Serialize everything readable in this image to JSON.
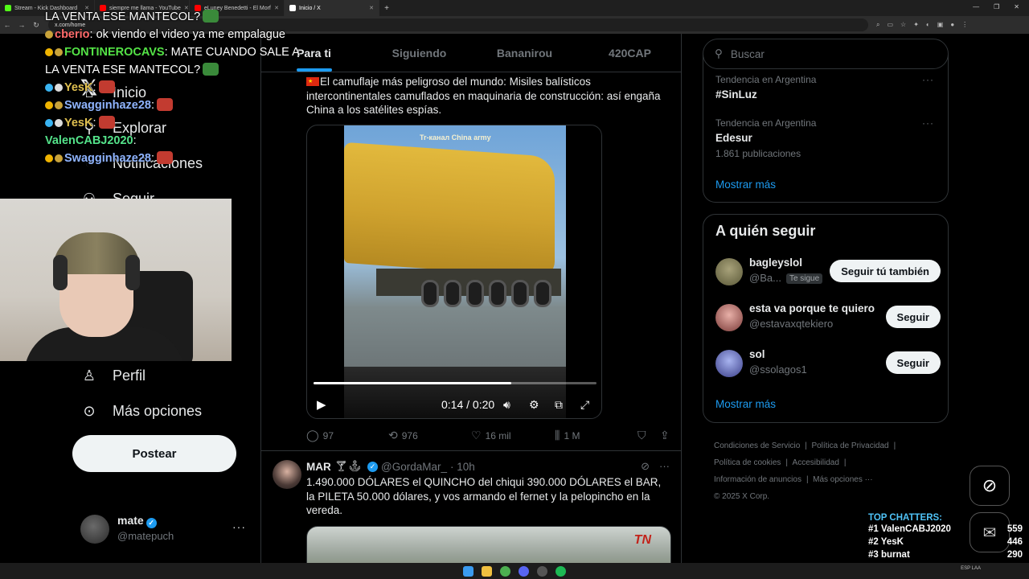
{
  "browser": {
    "tabs": [
      {
        "label": "Stream - Kick Dashboard",
        "color": "#53fc18"
      },
      {
        "label": "siempre me llama - YouTube",
        "color": "#ff0000"
      },
      {
        "label": "eLuney Benedetti - El Morf",
        "color": "#ff0000"
      },
      {
        "label": "Inicio / X",
        "color": "#ffffff"
      }
    ],
    "url": "x.com/home"
  },
  "chat": {
    "lines": [
      {
        "user": "",
        "text": "LA VENTA ESE MANTECOL?",
        "color": "#ffffff"
      },
      {
        "user": "cberio",
        "text": ": ok viendo el video ya me empalague",
        "color": "#ff6b6b"
      },
      {
        "user": "FONTINEROCAVS",
        "text": ": MATE CUANDO SALE A",
        "color": "#54e346"
      },
      {
        "user": "",
        "text": "LA VENTA ESE MANTECOL?",
        "color": "#ffffff"
      },
      {
        "user": "YesK",
        "text": ":",
        "color": "#e0c050"
      },
      {
        "user": "Swagginhaze28",
        "text": ":",
        "color": "#8fb4ff"
      },
      {
        "user": "YesK",
        "text": ":",
        "color": "#e0c050"
      },
      {
        "user": "ValenCABJ2020",
        "text": ":",
        "color": "#54e38a"
      },
      {
        "user": "Swagginhaze28",
        "text": ":",
        "color": "#8fb4ff"
      }
    ]
  },
  "nav": {
    "items": [
      {
        "label": "Inicio",
        "icon": "home-icon"
      },
      {
        "label": "Explorar",
        "icon": "search-icon"
      },
      {
        "label": "Notificaciones",
        "icon": "bell-icon"
      },
      {
        "label": "Seguir",
        "icon": "follow-icon"
      },
      {
        "label": "Perfil",
        "icon": "profile-icon"
      },
      {
        "label": "Más opciones",
        "icon": "more-icon"
      }
    ],
    "post_button": "Postear",
    "profile": {
      "name": "mate",
      "handle": "@matepuch"
    }
  },
  "feed": {
    "tabs": [
      "Para ti",
      "Siguiendo",
      "Bananirou",
      "420CAP"
    ],
    "post1": {
      "text": "El camuflaje más peligroso del mundo: Misiles balísticos intercontinentales camuflados en maquinaria de construcción: así engaña China a los satélites espías.",
      "video_caption": "Tr-канал China army",
      "video_time": "0:14 / 0:20",
      "video_progress": 0.7,
      "replies": "97",
      "reposts": "976",
      "likes": "16 mil",
      "views": "1 M"
    },
    "post2": {
      "name": "MAR",
      "handle": "@GordaMar_",
      "time": "· 10h",
      "text": "1.490.000 DÓLARES el QUINCHO del chiqui 390.000 DÓLARES el BAR, la PILETA 50.000 dólares, y vos armando el fernet y la pelopincho en la vereda.",
      "image_logo": "TN"
    }
  },
  "right": {
    "search_placeholder": "Buscar",
    "trends": [
      {
        "category": "Tendencia en Argentina",
        "title": "#SinLuz",
        "count": ""
      },
      {
        "category": "Tendencia en Argentina",
        "title": "Edesur",
        "count": "1.861 publicaciones"
      }
    ],
    "show_more": "Mostrar más",
    "who_to_follow_title": "A quién seguir",
    "follow": [
      {
        "name": "bagleyslol",
        "handle": "@Ba...",
        "tag": "Te sigue",
        "button": "Seguir tú también",
        "avatar_color": "#8a8a5a"
      },
      {
        "name": "esta va porque te quiero",
        "handle": "@estavaxqtekiero",
        "tag": "",
        "button": "Seguir",
        "avatar_color": "#c47a78"
      },
      {
        "name": "sol",
        "handle": "@ssolagos1",
        "tag": "",
        "button": "Seguir",
        "avatar_color": "#6d7fd0"
      }
    ],
    "show_more_2": "Mostrar más",
    "footer": [
      "Condiciones de Servicio",
      "Política de Privacidad",
      "Política de cookies",
      "Accesibilidad",
      "Información de anuncios",
      "Más opciones ···",
      "© 2025 X Corp."
    ]
  },
  "top_chatters": {
    "title": "TOP CHATTERS:",
    "rows": [
      {
        "rank": "#1",
        "name": "ValenCABJ2020",
        "count": "559"
      },
      {
        "rank": "#2",
        "name": "YesK",
        "count": "446"
      },
      {
        "rank": "#3",
        "name": "burnat",
        "count": "290"
      }
    ]
  },
  "taskbar": {
    "lang": "ESP LAA"
  }
}
